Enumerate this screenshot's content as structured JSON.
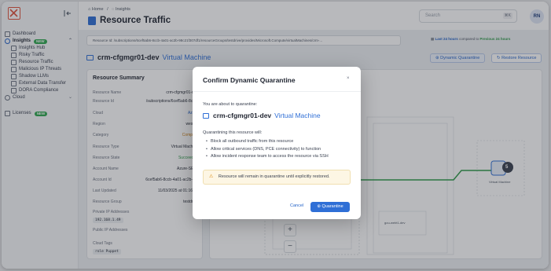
{
  "sidebar": {
    "items": [
      {
        "label": "Dashboard"
      },
      {
        "label": "Insights",
        "badge": "NEW"
      },
      {
        "label": "Insights Hub"
      },
      {
        "label": "Risky Traffic"
      },
      {
        "label": "Resource Traffic"
      },
      {
        "label": "Malicious IP Threats"
      },
      {
        "label": "Shadow LLMs"
      },
      {
        "label": "External Data Transfer"
      },
      {
        "label": "DORA Compliance"
      },
      {
        "label": "Cloud"
      },
      {
        "label": "Licenses",
        "badge": "NEW"
      }
    ]
  },
  "header": {
    "breadcrumb_home": "Home",
    "breadcrumb_sep": "/",
    "breadcrumb_insights": "Insights",
    "title": "Resource Traffic",
    "search_placeholder": "Search",
    "search_shortcut": "⌘K",
    "avatar": "RN"
  },
  "resource_bar": {
    "text": "Resource Id: /subscriptions/6cef5ab6-8ccb-4a01-ac2b-98c21f307df1/resourceGroups/testdrive/provides/Microsoft.Compute/virtualMachines/crm-...",
    "time_label": "Last 24 hours",
    "compared_to": "compared to",
    "previous": "Previous 24 hours"
  },
  "vm": {
    "name": "crm-cfgmgr01-dev",
    "type": "Virtual Machine",
    "dq_button": "Dynamic Quarantine",
    "restore_button": "Restore Resource"
  },
  "summary": {
    "heading": "Resource Summary",
    "rows": [
      {
        "k": "Resource Name",
        "v": "crm-cfgmgr01-dev"
      },
      {
        "k": "Resource Id",
        "v": "/subscriptions/6cef5ab6-8cc..."
      },
      {
        "k": "Cloud",
        "v": "Azure"
      },
      {
        "k": "Region",
        "v": "westus"
      },
      {
        "k": "Category",
        "v": "Compute"
      },
      {
        "k": "Resource Type",
        "v": "Virtual Machine"
      },
      {
        "k": "Resource State",
        "v": "Succeeded"
      },
      {
        "k": "Account Name",
        "v": "Azure-SE75"
      },
      {
        "k": "Account Id",
        "v": "6cef5ab6-8ccb-4a01-ac2b-9..."
      },
      {
        "k": "Last Updated",
        "v": "11/03/2025 at 01:16:06"
      },
      {
        "k": "Resource Group",
        "v": "testdrive"
      }
    ],
    "private_ip_label": "Private IP Addresses",
    "private_ip": "192.168.1.49",
    "public_ip_label": "Public IP Addresses",
    "tags_label": "Cloud Tags",
    "tag_key": "role",
    "tag_value": "Puppet"
  },
  "graph": {
    "node_label": "Virtual Machine",
    "node_count": "5",
    "small_label": "gou-webt1-dev",
    "zoom_in": "+",
    "zoom_out": "−"
  },
  "modal": {
    "title": "Confirm Dynamic Quarantine",
    "close": "×",
    "intro": "You are about to quarantine:",
    "resource_name": "crm-cfgmgr01-dev",
    "resource_type": "Virtual Machine",
    "will_text": "Quarantining this resource will:",
    "bullets": [
      "Block all outbound traffic from this resource",
      "Allow critical services (DNS, PCE connectivity) to function",
      "Allow incident response team to access the resource via SSH"
    ],
    "warning": "Resource will remain in quarantine until explicitly restored.",
    "cancel": "Cancel",
    "confirm": "Quarantine"
  },
  "colors": {
    "accent": "#2f6fd6",
    "success": "#2f9a4a",
    "warning_bg": "#fdf6e4",
    "brand": "#e0533d"
  }
}
